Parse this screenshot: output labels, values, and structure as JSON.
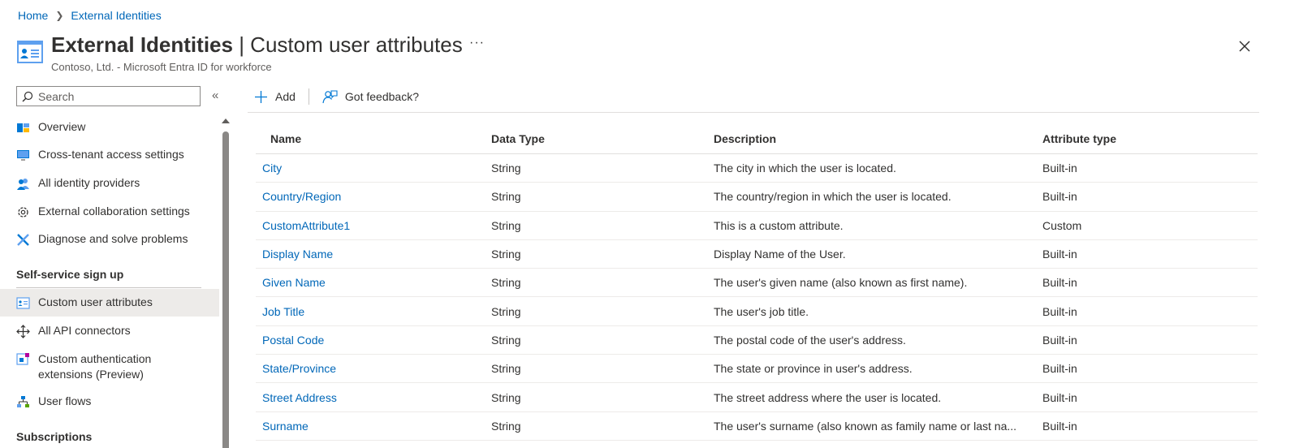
{
  "breadcrumb": {
    "home": "Home",
    "current": "External Identities"
  },
  "header": {
    "title_strong": "External Identities",
    "title_sep": " | ",
    "title_rest": "Custom user attributes",
    "more": "···",
    "subtitle": "Contoso, Ltd. - Microsoft Entra ID for workforce"
  },
  "sidebar": {
    "search_placeholder": "Search",
    "collapse": "«",
    "items": [
      {
        "label": "Overview",
        "icon": "overview-icon"
      },
      {
        "label": "Cross-tenant access settings",
        "icon": "monitor-icon"
      },
      {
        "label": "All identity providers",
        "icon": "users-icon"
      },
      {
        "label": "External collaboration settings",
        "icon": "gear-icon"
      },
      {
        "label": "Diagnose and solve problems",
        "icon": "wrench-icon"
      }
    ],
    "section_label": "Self-service sign up",
    "section_items": [
      {
        "label": "Custom user attributes",
        "icon": "attributes-icon",
        "selected": true
      },
      {
        "label": "All API connectors",
        "icon": "connector-icon"
      },
      {
        "label": "Custom authentication extensions (Preview)",
        "icon": "extension-icon"
      },
      {
        "label": "User flows",
        "icon": "userflow-icon"
      }
    ],
    "next_section_label": "Subscriptions"
  },
  "toolbar": {
    "add_label": "Add",
    "feedback_label": "Got feedback?"
  },
  "table": {
    "columns": [
      "Name",
      "Data Type",
      "Description",
      "Attribute type"
    ],
    "rows": [
      {
        "name": "City",
        "type": "String",
        "description": "The city in which the user is located.",
        "attr": "Built-in"
      },
      {
        "name": "Country/Region",
        "type": "String",
        "description": "The country/region in which the user is located.",
        "attr": "Built-in"
      },
      {
        "name": "CustomAttribute1",
        "type": "String",
        "description": "This is a custom attribute.",
        "attr": "Custom"
      },
      {
        "name": "Display Name",
        "type": "String",
        "description": "Display Name of the User.",
        "attr": "Built-in"
      },
      {
        "name": "Given Name",
        "type": "String",
        "description": "The user's given name (also known as first name).",
        "attr": "Built-in"
      },
      {
        "name": "Job Title",
        "type": "String",
        "description": "The user's job title.",
        "attr": "Built-in"
      },
      {
        "name": "Postal Code",
        "type": "String",
        "description": "The postal code of the user's address.",
        "attr": "Built-in"
      },
      {
        "name": "State/Province",
        "type": "String",
        "description": "The state or province in user's address.",
        "attr": "Built-in"
      },
      {
        "name": "Street Address",
        "type": "String",
        "description": "The street address where the user is located.",
        "attr": "Built-in"
      },
      {
        "name": "Surname",
        "type": "String",
        "description": "The user's surname (also known as family name or last na...",
        "attr": "Built-in"
      }
    ]
  }
}
